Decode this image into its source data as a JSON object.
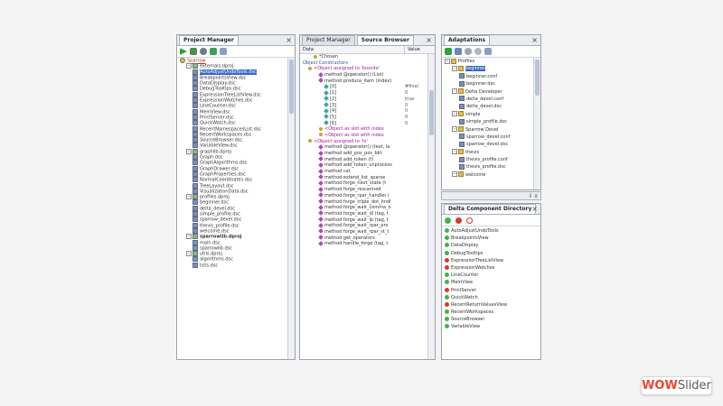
{
  "project_manager": {
    "title": "Project Manager",
    "close": "×",
    "root": "Sparrow",
    "items": [
      {
        "text": "externals.dproj",
        "kind": "prj",
        "indent": 1
      },
      {
        "text": "AutoAdjustUndoTools.dsc",
        "kind": "doc",
        "indent": 2,
        "selected": true
      },
      {
        "text": "BreakpointsView.dsc",
        "kind": "doc",
        "indent": 2
      },
      {
        "text": "DataDisplay.dsc",
        "kind": "doc",
        "indent": 2
      },
      {
        "text": "DebugTooltips.dsc",
        "kind": "doc",
        "indent": 2
      },
      {
        "text": "ExpressionTreeListView.dsc",
        "kind": "doc",
        "indent": 2
      },
      {
        "text": "ExpressionWatches.dsc",
        "kind": "doc",
        "indent": 2
      },
      {
        "text": "LineCounter.dsc",
        "kind": "doc",
        "indent": 2
      },
      {
        "text": "MemView.dsc",
        "kind": "doc",
        "indent": 2
      },
      {
        "text": "PrintServer.dsc",
        "kind": "doc",
        "indent": 2
      },
      {
        "text": "QuickWatch.dsc",
        "kind": "doc",
        "indent": 2
      },
      {
        "text": "RecentNamespacesList.dsc",
        "kind": "doc",
        "indent": 2
      },
      {
        "text": "RecentWorkspaces.dsc",
        "kind": "doc",
        "indent": 2
      },
      {
        "text": "SourceBrowser.dsc",
        "kind": "doc",
        "indent": 2
      },
      {
        "text": "VariableView.dsc",
        "kind": "doc",
        "indent": 2
      },
      {
        "text": "graphlib.dproj",
        "kind": "prj",
        "indent": 1
      },
      {
        "text": "Graph.dsc",
        "kind": "doc",
        "indent": 2
      },
      {
        "text": "GraphAlgorithms.dsc",
        "kind": "doc",
        "indent": 2
      },
      {
        "text": "GraphDrawer.dsc",
        "kind": "doc",
        "indent": 2
      },
      {
        "text": "GraphProperties.dsc",
        "kind": "doc",
        "indent": 2
      },
      {
        "text": "NormalCoordinates.dsc",
        "kind": "doc",
        "indent": 2
      },
      {
        "text": "TreeLayout.dsc",
        "kind": "doc",
        "indent": 2
      },
      {
        "text": "VisualizationData.dsc",
        "kind": "doc",
        "indent": 2
      },
      {
        "text": "profiles.dproj",
        "kind": "prj",
        "indent": 1
      },
      {
        "text": "beginner.dsc",
        "kind": "doc",
        "indent": 2
      },
      {
        "text": "delta_devel.dsc",
        "kind": "doc",
        "indent": 2
      },
      {
        "text": "simple_profile.dsc",
        "kind": "doc",
        "indent": 2
      },
      {
        "text": "sparrow_devel.dsc",
        "kind": "doc",
        "indent": 2
      },
      {
        "text": "thevis_profile.dsc",
        "kind": "doc",
        "indent": 2
      },
      {
        "text": "welcome.dsc",
        "kind": "doc",
        "indent": 2
      },
      {
        "text": "sparrowlib.dproj",
        "kind": "prj",
        "indent": 1,
        "bold": true
      },
      {
        "text": "main.dsc",
        "kind": "doc",
        "indent": 2
      },
      {
        "text": "sparrowlib.dsc",
        "kind": "doc",
        "indent": 2
      },
      {
        "text": "utils.dproj",
        "kind": "prj",
        "indent": 1
      },
      {
        "text": "algorithms.dsc",
        "kind": "doc",
        "indent": 2
      },
      {
        "text": "lists.dsc",
        "kind": "doc",
        "indent": 2
      }
    ]
  },
  "source_browser": {
    "tabs": [
      "Project Manager",
      "Source Browser"
    ],
    "close": "×",
    "columns": [
      "Data",
      "Value"
    ],
    "rows": [
      {
        "text": "*Chosen",
        "icon": "dot",
        "indent": 2,
        "val": ""
      },
      {
        "text": "Object Constructors",
        "icon": "none",
        "indent": 0,
        "val": "",
        "blue": true
      },
      {
        "text": "<Object assigned to 'boxsite'",
        "icon": "dot",
        "indent": 1,
        "val": "",
        "mag": true
      },
      {
        "text": "method @operator() (List)",
        "icon": "dia",
        "indent": 3,
        "val": ""
      },
      {
        "text": "method produce_item (index)",
        "icon": "dia",
        "indent": 3,
        "val": ""
      },
      {
        "text": "[0]",
        "icon": "teal",
        "indent": 4,
        "val": "#final"
      },
      {
        "text": "[1]",
        "icon": "teal",
        "indent": 4,
        "val": "0"
      },
      {
        "text": "[2]",
        "icon": "teal",
        "indent": 4,
        "val": "true"
      },
      {
        "text": "[3]",
        "icon": "teal",
        "indent": 4,
        "val": "0"
      },
      {
        "text": "[4]",
        "icon": "teal",
        "indent": 4,
        "val": "0"
      },
      {
        "text": "[5]",
        "icon": "teal",
        "indent": 4,
        "val": "0"
      },
      {
        "text": "[6]",
        "icon": "teal",
        "indent": 4,
        "val": "0"
      },
      {
        "text": "<Object as slot with index",
        ">": "",
        "icon": "dot",
        "indent": 3,
        "val": "",
        "mag": true
      },
      {
        "text": "<Object as slot with index",
        "icon": "dot",
        "indent": 3,
        "val": "",
        "mag": true
      },
      {
        "text": "<Object assigned to 'hi'",
        "icon": "dot",
        "indent": 1,
        "val": "",
        "mag": true
      },
      {
        "text": "method @operator() (text, la",
        "icon": "dia",
        "indent": 3,
        "val": ""
      },
      {
        "text": "method add_pos_pos_bkt",
        "icon": "dia",
        "indent": 3,
        "val": ""
      },
      {
        "text": "method add_token (t)",
        "icon": "dia",
        "indent": 3,
        "val": ""
      },
      {
        "text": "method add_token_unprocess",
        "icon": "dia",
        "indent": 3,
        "val": ""
      },
      {
        "text": "method cat",
        "icon": "dia",
        "indent": 3,
        "val": ""
      },
      {
        "text": "method extend_list_sparse",
        "icon": "dia",
        "indent": 3,
        "val": ""
      },
      {
        "text": "method forge_next_state (t",
        "icon": "dia",
        "indent": 3,
        "val": ""
      },
      {
        "text": "method forge_rescanned",
        "icon": "dia",
        "indent": 3,
        "val": ""
      },
      {
        "text": "method forge_rpar_handler (",
        "icon": "dia",
        "indent": 3,
        "val": ""
      },
      {
        "text": "method forge_triple_dot_hndl",
        "icon": "dia",
        "indent": 3,
        "val": ""
      },
      {
        "text": "method forge_wait_comma_o",
        "icon": "dia",
        "indent": 3,
        "val": ""
      },
      {
        "text": "method forge_wait_id (tag, t",
        "icon": "dia",
        "indent": 3,
        "val": ""
      },
      {
        "text": "method forge_wait_lp (tag, t",
        "icon": "dia",
        "indent": 3,
        "val": ""
      },
      {
        "text": "method forge_wait_rpar_pro",
        "icon": "dia",
        "indent": 3,
        "val": ""
      },
      {
        "text": "method forge_wait_rpar_st_t",
        "icon": "dia",
        "indent": 3,
        "val": ""
      },
      {
        "text": "method get_operators",
        "icon": "dia",
        "indent": 3,
        "val": ""
      },
      {
        "text": "method handle_forge (tag, t",
        "icon": "dia",
        "indent": 3,
        "val": ""
      }
    ]
  },
  "adaptations": {
    "title": "Adaptations",
    "close": "×",
    "rows": [
      {
        "text": "Profiles",
        "indent": 0,
        "type": "folder"
      },
      {
        "text": "beginner",
        "indent": 1,
        "type": "folder",
        "selected": true
      },
      {
        "text": "beginner.conf",
        "indent": 2,
        "type": "doc"
      },
      {
        "text": "beginner.dsc",
        "indent": 2,
        "type": "doc"
      },
      {
        "text": "Delta Developer",
        "indent": 1,
        "type": "folder"
      },
      {
        "text": "delta_devel.conf",
        "indent": 2,
        "type": "doc"
      },
      {
        "text": "delta_devel.dsc",
        "indent": 2,
        "type": "doc"
      },
      {
        "text": "simple",
        "indent": 1,
        "type": "folder"
      },
      {
        "text": "simple_profile.dsc",
        "indent": 2,
        "type": "doc"
      },
      {
        "text": "Sparrow Devel",
        "indent": 1,
        "type": "folder"
      },
      {
        "text": "sparrow_devel.conf",
        "indent": 2,
        "type": "doc"
      },
      {
        "text": "sparrow_devel.dsc",
        "indent": 2,
        "type": "doc"
      },
      {
        "text": "thevis",
        "indent": 1,
        "type": "folder"
      },
      {
        "text": "thevis_profile.conf",
        "indent": 2,
        "type": "doc"
      },
      {
        "text": "thevis_profile.dsc",
        "indent": 2,
        "type": "doc"
      },
      {
        "text": "welcome",
        "indent": 1,
        "type": "folder"
      }
    ],
    "pin_label": "⇩ x"
  },
  "delta_directory": {
    "title": "Delta Component Directory",
    "close": "×",
    "items": [
      {
        "text": "AutoAdjustUndoTools",
        "status": "green"
      },
      {
        "text": "BreakpointsView",
        "status": "green"
      },
      {
        "text": "DataDisplay",
        "status": "green"
      },
      {
        "text": "DebugTooltips",
        "status": "green"
      },
      {
        "text": "ExpressionTreeListView",
        "status": "red"
      },
      {
        "text": "ExpressionWatches",
        "status": "red"
      },
      {
        "text": "LineCounter",
        "status": "green"
      },
      {
        "text": "MemView",
        "status": "green"
      },
      {
        "text": "PrintServer",
        "status": "red"
      },
      {
        "text": "QuickWatch",
        "status": "green"
      },
      {
        "text": "RecentReturnValuesView",
        "status": "red"
      },
      {
        "text": "RecentWorkspaces",
        "status": "green"
      },
      {
        "text": "SourceBrowser",
        "status": "green"
      },
      {
        "text": "VariableView",
        "status": "green"
      }
    ]
  },
  "watermark": {
    "part1": "WOW",
    "part2": "Slider"
  },
  "colors": {
    "selection": "#3769c6",
    "green": "#3fb449",
    "red": "#d63b2c",
    "brand": "#e8482f"
  }
}
